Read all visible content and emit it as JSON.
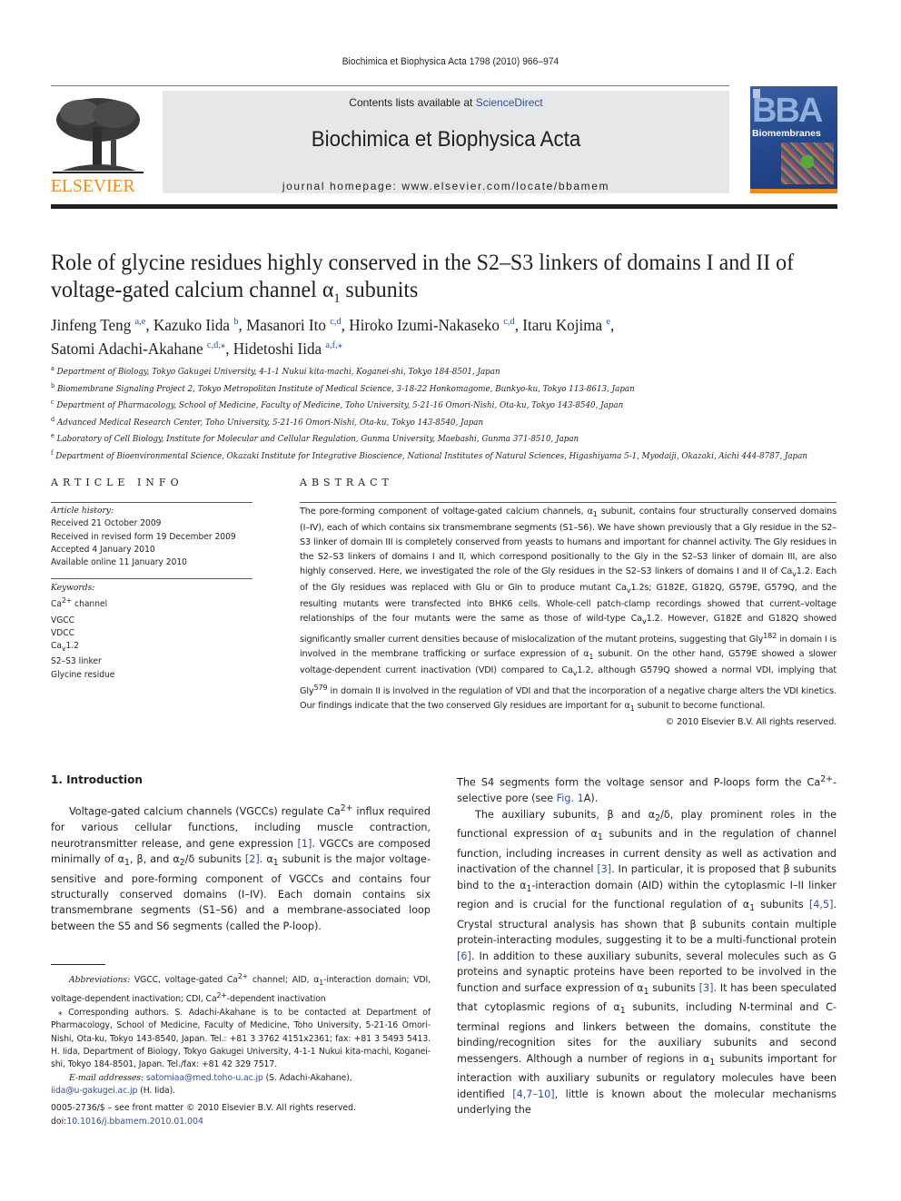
{
  "header": {
    "running_head": "Biochimica et Biophysica Acta 1798 (2010) 966–974",
    "publisher_logo": "ELSEVIER",
    "contents_prefix": "Contents lists available at ",
    "contents_link": "ScienceDirect",
    "journal_title": "Biochimica et Biophysica Acta",
    "homepage": "journal homepage: www.elsevier.com/locate/bbamem",
    "cover": {
      "big": "BBA",
      "subtitle": "Biomembranes"
    },
    "colors": {
      "elsevier_orange": "#f08a1e",
      "link_blue": "#2f4fa8",
      "panel_gray": "#e6e7e8",
      "cover_blue": "#24488d"
    }
  },
  "article": {
    "title_part1": "Role of glycine residues highly conserved in the S2–S3 linkers of domains I and II of",
    "title_part2": "voltage-gated calcium channel α",
    "title_sub": "1",
    "title_part3": " subunits",
    "authors": [
      {
        "name": "Jinfeng Teng",
        "aff": "a,e",
        "sep": ", "
      },
      {
        "name": "Kazuko Iida",
        "aff": "b",
        "sep": ", "
      },
      {
        "name": "Masanori Ito",
        "aff": "c,d",
        "sep": ", "
      },
      {
        "name": "Hiroko Izumi-Nakaseko",
        "aff": "c,d",
        "sep": ", "
      },
      {
        "name": "Itaru Kojima",
        "aff": "e",
        "sep": ","
      },
      {
        "name": "Satomi Adachi-Akahane",
        "aff": "c,d,⁎",
        "sep": ", "
      },
      {
        "name": "Hidetoshi Iida",
        "aff": "a,f,⁎",
        "sep": ""
      }
    ],
    "affiliations": [
      {
        "key": "a",
        "text": "Department of Biology, Tokyo Gakugei University, 4-1-1 Nukui kita-machi, Koganei-shi, Tokyo 184-8501, Japan"
      },
      {
        "key": "b",
        "text": "Biomembrane Signaling Project 2, Tokyo Metropolitan Institute of Medical Science, 3-18-22 Honkomagome, Bunkyo-ku, Tokyo 113-8613, Japan"
      },
      {
        "key": "c",
        "text": "Department of Pharmacology, School of Medicine, Faculty of Medicine, Toho University, 5-21-16 Omori-Nishi, Ota-ku, Tokyo 143-8540, Japan"
      },
      {
        "key": "d",
        "text": "Advanced Medical Research Center, Toho University, 5-21-16 Omori-Nishi, Ota-ku, Tokyo 143-8540, Japan"
      },
      {
        "key": "e",
        "text": "Laboratory of Cell Biology, Institute for Molecular and Cellular Regulation, Gunma University, Maebashi, Gunma 371-8510, Japan"
      },
      {
        "key": "f",
        "text": "Department of Bioenvironmental Science, Okazaki Institute for Integrative Bioscience, National Institutes of Natural Sciences, Higashiyama 5-1, Myodaiji, Okazaki, Aichi 444-8787, Japan"
      }
    ]
  },
  "article_info": {
    "heading": "ARTICLE INFO",
    "history_label": "Article history:",
    "history": [
      "Received 21 October 2009",
      "Received in revised form 19 December 2009",
      "Accepted 4 January 2010",
      "Available online 11 January 2010"
    ],
    "keywords_label": "Keywords:",
    "keywords": [
      {
        "base": "Ca",
        "sup": "2+",
        "sub": "",
        "rest": " channel"
      },
      {
        "base": "VGCC",
        "sup": "",
        "sub": "",
        "rest": ""
      },
      {
        "base": "VDCC",
        "sup": "",
        "sub": "",
        "rest": ""
      },
      {
        "base": "Ca",
        "sup": "",
        "sub": "v",
        "rest": "1.2"
      },
      {
        "base": "S2–S3 linker",
        "sup": "",
        "sub": "",
        "rest": ""
      },
      {
        "base": "Glycine residue",
        "sup": "",
        "sub": "",
        "rest": ""
      }
    ]
  },
  "abstract": {
    "heading": "ABSTRACT",
    "text_html": "The pore-forming component of voltage-gated calcium channels, α<sub>1</sub> subunit, contains four structurally conserved domains (I–IV), each of which contains six transmembrane segments (S1–S6). We have shown previously that a Gly residue in the S2–S3 linker of domain III is completely conserved from yeasts to humans and important for channel activity. The Gly residues in the S2–S3 linkers of domains I and II, which correspond positionally to the Gly in the S2–S3 linker of domain III, are also highly conserved. Here, we investigated the role of the Gly residues in the S2–S3 linkers of domains I and II of Ca<sub>v</sub>1.2. Each of the Gly residues was replaced with Glu or Gln to produce mutant Ca<sub>v</sub>1.2s; G182E, G182Q, G579E, G579Q, and the resulting mutants were transfected into BHK6 cells. Whole-cell patch-clamp recordings showed that current–voltage relationships of the four mutants were the same as those of wild-type Ca<sub>v</sub>1.2. However, G182E and G182Q showed significantly smaller current densities because of mislocalization of the mutant proteins, suggesting that Gly<sup>182</sup> in domain I is involved in the membrane trafficking or surface expression of α<sub>1</sub> subunit. On the other hand, G579E showed a slower voltage-dependent current inactivation (VDI) compared to Ca<sub>v</sub>1.2, although G579Q showed a normal VDI, implying that Gly<sup>579</sup> in domain II is involved in the regulation of VDI and that the incorporation of a negative charge alters the VDI kinetics. Our findings indicate that the two conserved Gly residues are important for α<sub>1</sub> subunit to become functional.",
    "copyright": "© 2010 Elsevier B.V. All rights reserved."
  },
  "introduction": {
    "heading": "1. Introduction",
    "left_html": "Voltage-gated calcium channels (VGCCs) regulate Ca<sup>2+</sup> influx required for various cellular functions, including muscle contraction, neurotransmitter release, and gene expression <span class=\"ref\">[1]</span>. VGCCs are composed minimally of α<sub>1</sub>, β, and α<sub>2</sub>/δ subunits <span class=\"ref\">[2]</span>. α<sub>1</sub> subunit is the major voltage-sensitive and pore-forming component of VGCCs and contains four structurally conserved domains (I–IV). Each domain contains six transmembrane segments (S1–S6) and a membrane-associated loop between the S5 and S6 segments (called the P-loop).",
    "right_p1_html": "The S4 segments form the voltage sensor and P-loops form the Ca<sup>2+</sup>-selective pore (see <span class=\"ref\">Fig. 1</span>A).",
    "right_p2_html": "The auxiliary subunits, β and α<sub>2</sub>/δ, play prominent roles in the functional expression of α<sub>1</sub> subunits and in the regulation of channel function, including increases in current density as well as activation and inactivation of the channel <span class=\"ref\">[3]</span>. In particular, it is proposed that β subunits bind to the α<sub>1</sub>-interaction domain (AID) within the cytoplasmic I–II linker region and is crucial for the functional regulation of α<sub>1</sub> subunits <span class=\"ref\">[4,5]</span>. Crystal structural analysis has shown that β subunits contain multiple protein-interacting modules, suggesting it to be a multi-functional protein <span class=\"ref\">[6]</span>. In addition to these auxiliary subunits, several molecules such as G proteins and synaptic proteins have been reported to be involved in the function and surface expression of α<sub>1</sub> subunits <span class=\"ref\">[3]</span>. It has been speculated that cytoplasmic regions of α<sub>1</sub> subunits, including N-terminal and C-terminal regions and linkers between the domains, constitute the binding/recognition sites for the auxiliary subunits and second messengers. Although a number of regions in α<sub>1</sub> subunits important for interaction with auxiliary subunits or regulatory molecules have been identified <span class=\"ref\">[4,7–10]</span>, little is known about the molecular mechanisms underlying the"
  },
  "footnotes": {
    "abbrev_label": "Abbreviations:",
    "abbrev_html": " VGCC, voltage-gated Ca<sup>2+</sup> channel; AID, α<sub>1</sub>-interaction domain; VDI, voltage-dependent inactivation; CDI, Ca<sup>2+</sup>-dependent inactivation",
    "corresponding": "⁎ Corresponding authors. S. Adachi-Akahane is to be contacted at Department of Pharmacology, School of Medicine, Faculty of Medicine, Toho University, 5-21-16 Omori-Nishi, Ota-ku, Tokyo 143-8540, Japan. Tel.: +81 3 3762 4151x2361; fax: +81 3 5493 5413. H. Iida, Department of Biology, Tokyo Gakugei University, 4-1-1 Nukui kita-machi, Koganei-shi, Tokyo 184-8501, Japan. Tel./fax: +81 42 329 7517.",
    "email_label": "E-mail addresses:",
    "email1": "satomiaa@med.toho-u.ac.jp",
    "email1_owner": " (S. Adachi-Akahane),",
    "email2": "iida@u-gakugei.ac.jp",
    "email2_owner": " (H. Iida)."
  },
  "front_matter": {
    "issn_line": "0005-2736/$ – see front matter © 2010 Elsevier B.V. All rights reserved.",
    "doi_prefix": "doi:",
    "doi": "10.1016/j.bbamem.2010.01.004"
  }
}
